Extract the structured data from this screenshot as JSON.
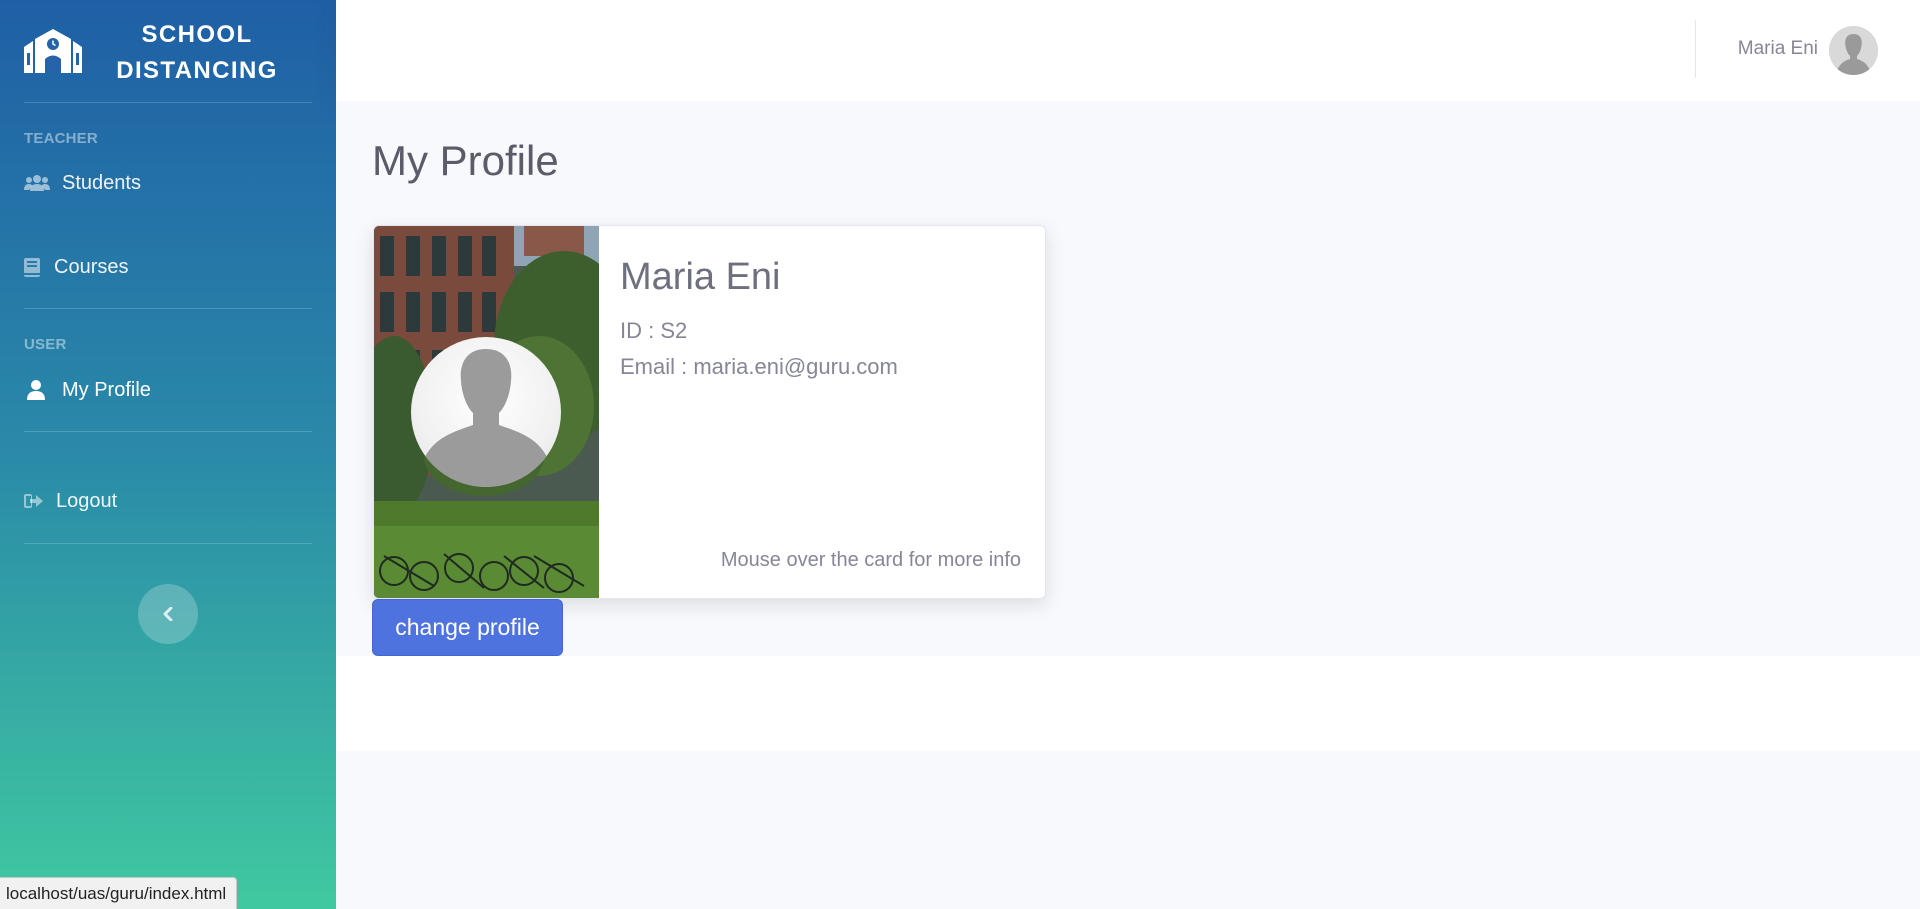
{
  "brand": {
    "line1": "SCHOOL",
    "line2": "DISTANCING",
    "icon": "school-building-icon"
  },
  "sidebar": {
    "sections": [
      {
        "heading": "TEACHER"
      },
      {
        "heading": "USER"
      }
    ],
    "items": [
      {
        "label": "Students",
        "icon": "users-icon"
      },
      {
        "label": "Courses",
        "icon": "book-icon"
      },
      {
        "label": "My Profile",
        "icon": "user-icon",
        "active": true
      },
      {
        "label": "Logout",
        "icon": "sign-out-icon"
      }
    ],
    "toggle_icon": "chevron-left-icon"
  },
  "topbar": {
    "user_name": "Maria Eni",
    "avatar": "default-avatar"
  },
  "main": {
    "title": "My Profile",
    "card": {
      "name": "Maria Eni",
      "id_line": "ID : S2",
      "email_line": "Email : maria.eni@guru.com",
      "hint": "Mouse over the card for more info"
    },
    "change_button": "change profile"
  },
  "status_bar": {
    "url": "localhost/uas/guru/index.html"
  },
  "colors": {
    "primary": "#4e73df",
    "sidebar_top": "#1f5fa6",
    "sidebar_bottom": "#40c9a0",
    "text_muted": "#858796"
  }
}
